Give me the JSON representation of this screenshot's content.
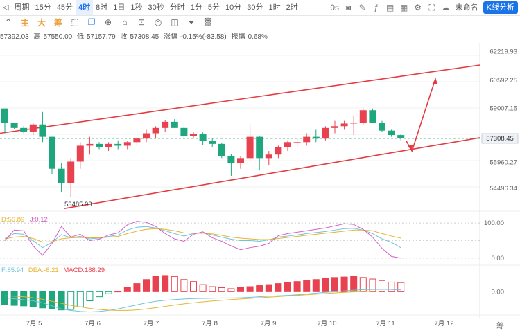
{
  "toolbar": {
    "timeframes": [
      "周期",
      "15分",
      "45分",
      "4时",
      "8时",
      "1日",
      "1秒",
      "30秒",
      "分时",
      "1分",
      "5分",
      "10分",
      "30分",
      "1时",
      "2时"
    ],
    "active_timeframe": "4时",
    "right_label": "未命名",
    "kline_btn": "K线分析"
  },
  "drawbar": {
    "items": [
      "主",
      "大",
      "筹"
    ]
  },
  "ohlc": {
    "open": "57392.03",
    "high_label": "高",
    "high": "57550.00",
    "low_label": "低",
    "low": "57157.79",
    "close_label": "收",
    "close": "57308.45",
    "change_label": "涨幅",
    "change": "-0.15%(-83.58)",
    "amp_label": "振幅",
    "amp": "0.68%"
  },
  "price_axis": [
    "62219.93",
    "60592.25",
    "59007.15",
    "57308.45",
    "55960.27",
    "54496.34"
  ],
  "current_price": "57308.45",
  "low_annotation": "53485.93",
  "x_axis": [
    "7月 5",
    "7月 6",
    "7月 7",
    "7月 8",
    "7月 9",
    "7月 10",
    "7月 11",
    "7月 12"
  ],
  "kdj": {
    "d_label": "D:56.89",
    "j_label": "J:0.12",
    "axis": [
      "100.00",
      "0.00"
    ]
  },
  "macd": {
    "dif_label": "F:85.94",
    "dea_label": "DEA:-8.21",
    "macd_label": "MACD:188.29",
    "axis": [
      "0.00"
    ]
  },
  "bottom_right": "筹",
  "colors": {
    "up": "#e8414f",
    "down": "#1ea67e",
    "channel": "#e53a40",
    "accent": "#1a73e8",
    "k": "#6ec3e0",
    "d": "#e7b431",
    "j": "#d45fc8"
  },
  "chart_data": {
    "type": "candlestick",
    "series": [
      {
        "name": "price",
        "candles": [
          [
            59000,
            59000,
            57600,
            58200
          ],
          [
            58200,
            58200,
            57850,
            57900
          ],
          [
            57900,
            58000,
            57600,
            57700
          ],
          [
            57700,
            58200,
            57500,
            58100
          ],
          [
            58100,
            58800,
            57100,
            57400
          ],
          [
            57400,
            57400,
            55300,
            55600
          ],
          [
            55600,
            55900,
            54300,
            54800
          ],
          [
            54800,
            56200,
            54000,
            56000
          ],
          [
            56000,
            57100,
            55600,
            56900
          ],
          [
            56900,
            57400,
            56400,
            57000
          ],
          [
            57000,
            57100,
            56700,
            56800
          ],
          [
            56800,
            57100,
            56600,
            57000
          ],
          [
            57000,
            57200,
            56700,
            56900
          ],
          [
            56900,
            57150,
            56700,
            57100
          ],
          [
            57100,
            57400,
            56900,
            57300
          ],
          [
            57300,
            57800,
            57100,
            57600
          ],
          [
            57600,
            58000,
            57300,
            57900
          ],
          [
            57900,
            58350,
            57700,
            58250
          ],
          [
            58250,
            58400,
            57900,
            57900
          ],
          [
            57900,
            57950,
            57300,
            57450
          ],
          [
            57450,
            57700,
            57300,
            57550
          ],
          [
            57550,
            57650,
            56950,
            57150
          ],
          [
            57150,
            57300,
            56800,
            57000
          ],
          [
            57000,
            57050,
            56200,
            56300
          ],
          [
            56300,
            56450,
            55200,
            55900
          ],
          [
            55900,
            56300,
            55600,
            56200
          ],
          [
            56200,
            58100,
            56000,
            57400
          ],
          [
            57400,
            57450,
            55500,
            56200
          ],
          [
            56200,
            56600,
            55800,
            56400
          ],
          [
            56400,
            56900,
            56200,
            56800
          ],
          [
            56800,
            57200,
            56600,
            57100
          ],
          [
            57100,
            57300,
            56800,
            57100
          ],
          [
            57100,
            57600,
            56900,
            57400
          ],
          [
            57400,
            57800,
            57100,
            57300
          ],
          [
            57300,
            58000,
            57200,
            57900
          ],
          [
            57900,
            58300,
            57600,
            58000
          ],
          [
            58000,
            58300,
            57800,
            58150
          ],
          [
            58150,
            58600,
            57500,
            58200
          ],
          [
            58200,
            59000,
            58100,
            58900
          ],
          [
            58900,
            59000,
            58200,
            58200
          ],
          [
            58200,
            58300,
            57700,
            57750
          ],
          [
            57750,
            57800,
            57400,
            57500
          ],
          [
            57500,
            57550,
            57158,
            57308
          ]
        ]
      }
    ],
    "channel": {
      "upper_start": 57600,
      "upper_end": 61450,
      "lower_start": 53350,
      "lower_end": 57350
    },
    "projection": [
      57150,
      56600,
      60700
    ],
    "ylim": [
      53400,
      62700
    ],
    "kdj": {
      "k": [
        56,
        70,
        68,
        50,
        30,
        45,
        67,
        58,
        62,
        55,
        57,
        62,
        66,
        80,
        88,
        90,
        86,
        78,
        70,
        63,
        70,
        72,
        66,
        60,
        54,
        50,
        50,
        48,
        52,
        60,
        63,
        66,
        70,
        73,
        76,
        80,
        84,
        85,
        80,
        70,
        55,
        45,
        30
      ],
      "d": [
        55,
        60,
        62,
        56,
        46,
        47,
        55,
        58,
        59,
        58,
        58,
        60,
        62,
        70,
        77,
        82,
        84,
        82,
        78,
        72,
        71,
        71,
        69,
        65,
        60,
        57,
        55,
        53,
        53,
        56,
        59,
        62,
        65,
        68,
        71,
        74,
        77,
        80,
        80,
        78,
        70,
        63,
        57
      ],
      "j": [
        50,
        80,
        78,
        35,
        8,
        42,
        90,
        60,
        68,
        50,
        54,
        66,
        72,
        95,
        105,
        102,
        90,
        70,
        55,
        48,
        68,
        75,
        58,
        48,
        35,
        24,
        30,
        34,
        42,
        64,
        70,
        74,
        78,
        82,
        86,
        92,
        98,
        96,
        82,
        60,
        28,
        5,
        0
      ],
      "ylim": [
        -10,
        120
      ]
    },
    "macd": {
      "hist": [
        -130,
        -135,
        -140,
        -150,
        -160,
        -170,
        -180,
        -175,
        -150,
        -90,
        -50,
        -20,
        5,
        40,
        80,
        120,
        150,
        160,
        150,
        120,
        100,
        70,
        50,
        40,
        30,
        40,
        50,
        60,
        70,
        80,
        90,
        100,
        110,
        120,
        130,
        140,
        145,
        150,
        140,
        125,
        110,
        95,
        90
      ],
      "dif": [
        -60,
        -70,
        -80,
        -90,
        -110,
        -140,
        -170,
        -185,
        -195,
        -200,
        -195,
        -185,
        -170,
        -150,
        -130,
        -110,
        -95,
        -85,
        -78,
        -72,
        -68,
        -66,
        -64,
        -62,
        -62,
        -60,
        -56,
        -50,
        -44,
        -40,
        -36,
        -30,
        -22,
        -14,
        -6,
        0,
        8,
        15,
        20,
        22,
        24,
        22,
        18
      ],
      "dea": [
        -40,
        -45,
        -50,
        -60,
        -75,
        -95,
        -115,
        -135,
        -150,
        -165,
        -175,
        -182,
        -185,
        -185,
        -180,
        -170,
        -158,
        -145,
        -132,
        -120,
        -110,
        -100,
        -92,
        -85,
        -78,
        -72,
        -66,
        -60,
        -54,
        -48,
        -42,
        -36,
        -30,
        -24,
        -18,
        -12,
        -6,
        -2,
        2,
        4,
        6,
        6,
        6
      ],
      "ylim": [
        -230,
        180
      ]
    }
  }
}
